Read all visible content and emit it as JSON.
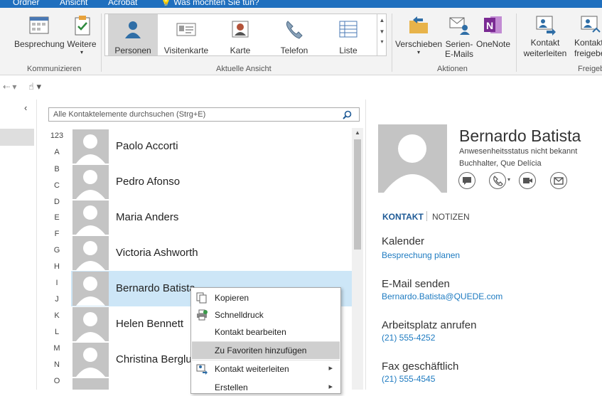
{
  "menubar": {
    "ordner": "Ordner",
    "ansicht": "Ansicht",
    "acrobat": "Acrobat",
    "tellme": "Was möchten Sie tun?"
  },
  "ribbon": {
    "besprechung": "Besprechung",
    "weitere": "Weitere",
    "kommunizieren": "Kommunizieren",
    "views": [
      "Personen",
      "Visitenkarte",
      "Karte",
      "Telefon",
      "Liste"
    ],
    "aktuelle_ansicht": "Aktuelle Ansicht",
    "verschieben": "Verschieben",
    "serien_line1": "Serien-",
    "serien_line2": "E-Mails",
    "onenote": "OneNote",
    "aktionen": "Aktionen",
    "kontakt_weiterleiten_1": "Kontakt",
    "kontakt_weiterleiten_2": "weiterleiten",
    "kontakt_freigeben_1": "Kontakt",
    "kontakt_freigeben_2": "freigebe",
    "freigeben_group": "Freigeb"
  },
  "search": {
    "placeholder": "Alle Kontaktelemente durchsuchen (Strg+E)"
  },
  "letters": [
    "123",
    "A",
    "B",
    "C",
    "D",
    "E",
    "F",
    "G",
    "H",
    "I",
    "J",
    "K",
    "L",
    "M",
    "N",
    "O"
  ],
  "contacts": [
    "Paolo Accorti",
    "Pedro Afonso",
    "Maria Anders",
    "Victoria Ashworth",
    "Bernardo Batista",
    "Helen Bennett",
    "Christina Berglu"
  ],
  "detail": {
    "name": "Bernardo Batista",
    "presence": "Anwesenheitsstatus nicht bekannt",
    "title": "Buchhalter, Que Delícia",
    "tab_kontakt": "KONTAKT",
    "tab_notizen": "NOTIZEN",
    "kalender": "Kalender",
    "besprechung_planen": "Besprechung planen",
    "email_senden": "E-Mail senden",
    "email": "Bernardo.Batista@QUEDE.com",
    "arbeitsplatz": "Arbeitsplatz anrufen",
    "arbeitsplatz_nr": "(21) 555-4252",
    "fax": "Fax geschäftlich",
    "fax_nr": "(21) 555-4545"
  },
  "context_menu": [
    "Kopieren",
    "Schnelldruck",
    "Kontakt bearbeiten",
    "Zu Favoriten hinzufügen",
    "Kontakt weiterleiten",
    "Erstellen"
  ],
  "colors": {
    "accent": "#1f6fbe",
    "link": "#1e7bc1",
    "selection": "#cde6f7"
  }
}
